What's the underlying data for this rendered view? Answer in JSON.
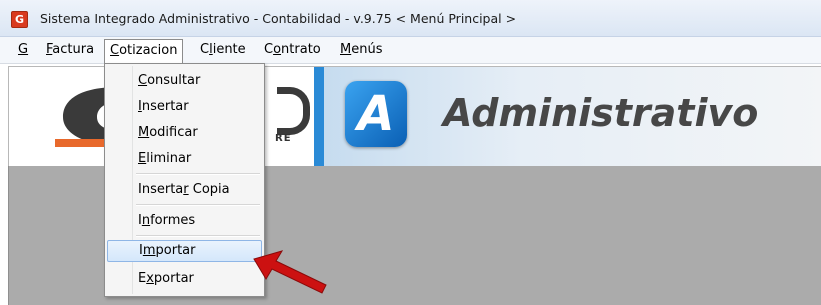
{
  "titlebar": {
    "icon_label": "G",
    "title": "Sistema Integrado Administrativo - Contabilidad - v.9.75 < Menú Principal >"
  },
  "menubar": {
    "items": [
      {
        "pre": "",
        "key": "G",
        "post": ""
      },
      {
        "pre": "",
        "key": "F",
        "post": "actura"
      },
      {
        "pre": "",
        "key": "C",
        "post": "otizacion"
      },
      {
        "pre": "C",
        "key": "l",
        "post": "iente"
      },
      {
        "pre": "C",
        "key": "o",
        "post": "ntrato"
      },
      {
        "pre": "",
        "key": "M",
        "post": "enús"
      }
    ]
  },
  "dropdown": {
    "items": [
      {
        "pre": "",
        "key": "C",
        "post": "onsultar"
      },
      {
        "pre": "",
        "key": "I",
        "post": "nsertar"
      },
      {
        "pre": "",
        "key": "M",
        "post": "odificar"
      },
      {
        "pre": "",
        "key": "E",
        "post": "liminar"
      },
      {
        "pre": "Inserta",
        "key": "r",
        "post": " Copia"
      },
      {
        "pre": "I",
        "key": "n",
        "post": "formes"
      },
      {
        "pre": "I",
        "key": "m",
        "post": "portar"
      },
      {
        "pre": "E",
        "key": "x",
        "post": "portar"
      }
    ]
  },
  "banner": {
    "logo_fragment": "RE",
    "a_letter": "A",
    "brand_text": "Administrativo"
  },
  "colors": {
    "accent_blue": "#2a8ad6",
    "logo_orange": "#e8692c",
    "arrow_red": "#cc1111",
    "workspace_gray": "#ababab"
  }
}
